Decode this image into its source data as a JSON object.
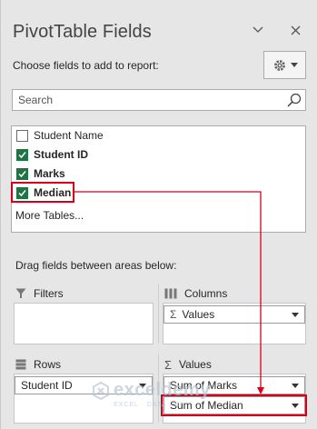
{
  "pane": {
    "title": "PivotTable Fields",
    "subtitle": "Choose fields to add to report:"
  },
  "search": {
    "placeholder": "Search"
  },
  "fields": [
    {
      "label": "Student Name",
      "checked": false,
      "bold": false
    },
    {
      "label": "Student ID",
      "checked": true,
      "bold": true
    },
    {
      "label": "Marks",
      "checked": true,
      "bold": true
    },
    {
      "label": "Median",
      "checked": true,
      "bold": true
    }
  ],
  "more_tables": "More Tables...",
  "drag_hint": "Drag fields between areas below:",
  "areas": {
    "filters": {
      "title": "Filters"
    },
    "columns": {
      "title": "Columns",
      "items": [
        "Values"
      ]
    },
    "rows": {
      "title": "Rows",
      "items": [
        "Student ID"
      ]
    },
    "values": {
      "title": "Values",
      "items": [
        "Sum of Marks",
        "Sum of Median"
      ]
    }
  },
  "watermark": {
    "brand": "exceldemy",
    "tagline": "EXCEL · DATA · BI"
  },
  "colors": {
    "accent": "#217346",
    "highlight": "#d6001c"
  }
}
